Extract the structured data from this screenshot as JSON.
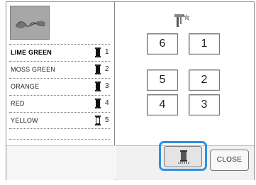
{
  "threads": [
    {
      "name": "LIME GREEN",
      "number": "1",
      "filled": true,
      "selected": true
    },
    {
      "name": "MOSS GREEN",
      "number": "2",
      "filled": true,
      "selected": false
    },
    {
      "name": "ORANGE",
      "number": "3",
      "filled": true,
      "selected": false
    },
    {
      "name": "RED",
      "number": "4",
      "filled": true,
      "selected": false
    },
    {
      "name": "YELLOW",
      "number": "5",
      "filled": false,
      "selected": false
    }
  ],
  "buttons": {
    "num_6": "6",
    "num_1": "1",
    "num_5": "5",
    "num_2": "2",
    "num_4": "4",
    "num_3": "3",
    "close": "CLOSE"
  },
  "colors": {
    "highlight": "#2f8fe3",
    "preview_bg": "#a7a7a7"
  },
  "icons": {
    "needle": "needle-threader-icon",
    "spool": "thread-spool-icon"
  }
}
